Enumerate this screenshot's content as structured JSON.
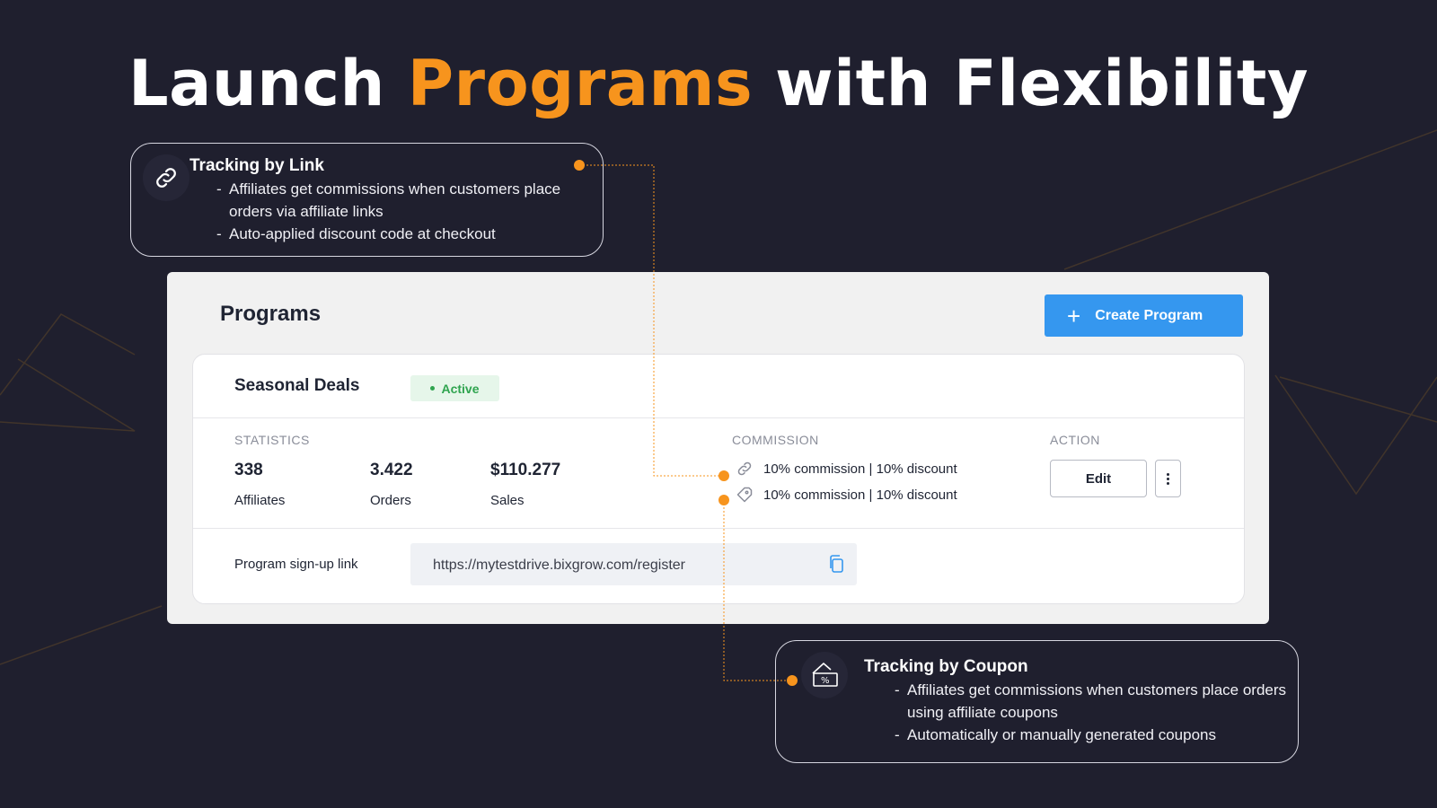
{
  "headline": {
    "part1": "Launch ",
    "accent": "Programs",
    "part2": " with Flexibility"
  },
  "callout_link": {
    "icon": "link-icon",
    "title": "Tracking by Link",
    "items": [
      "Affiliates get commissions when customers place orders via affiliate links",
      "Auto-applied discount code at checkout"
    ]
  },
  "callout_coupon": {
    "icon": "coupon-icon",
    "title": "Tracking by Coupon",
    "items": [
      "Affiliates get commissions when customers place orders using affiliate coupons",
      "Automatically or manually generated coupons"
    ]
  },
  "programs": {
    "title": "Programs",
    "create_button": "Create Program",
    "program": {
      "name": "Seasonal Deals",
      "status": "Active",
      "statistics_label": "STATISTICS",
      "stats": [
        {
          "value": "338",
          "label": "Affiliates"
        },
        {
          "value": "3.422",
          "label": "Orders"
        },
        {
          "value": "$110.277",
          "label": "Sales"
        }
      ],
      "commission_label": "COMMISSION",
      "commissions": [
        {
          "icon": "link-icon",
          "text": "10% commission | 10% discount"
        },
        {
          "icon": "coupon-icon",
          "text": "10% commission | 10% discount"
        }
      ],
      "action_label": "ACTION",
      "edit_button": "Edit",
      "signup_label": "Program sign-up link",
      "signup_url": "https://mytestdrive.bixgrow.com/register"
    }
  },
  "colors": {
    "background": "#1f1f2e",
    "accent": "#f7941d",
    "primary_button": "#3597ef",
    "status_active": "#2fa44f"
  }
}
